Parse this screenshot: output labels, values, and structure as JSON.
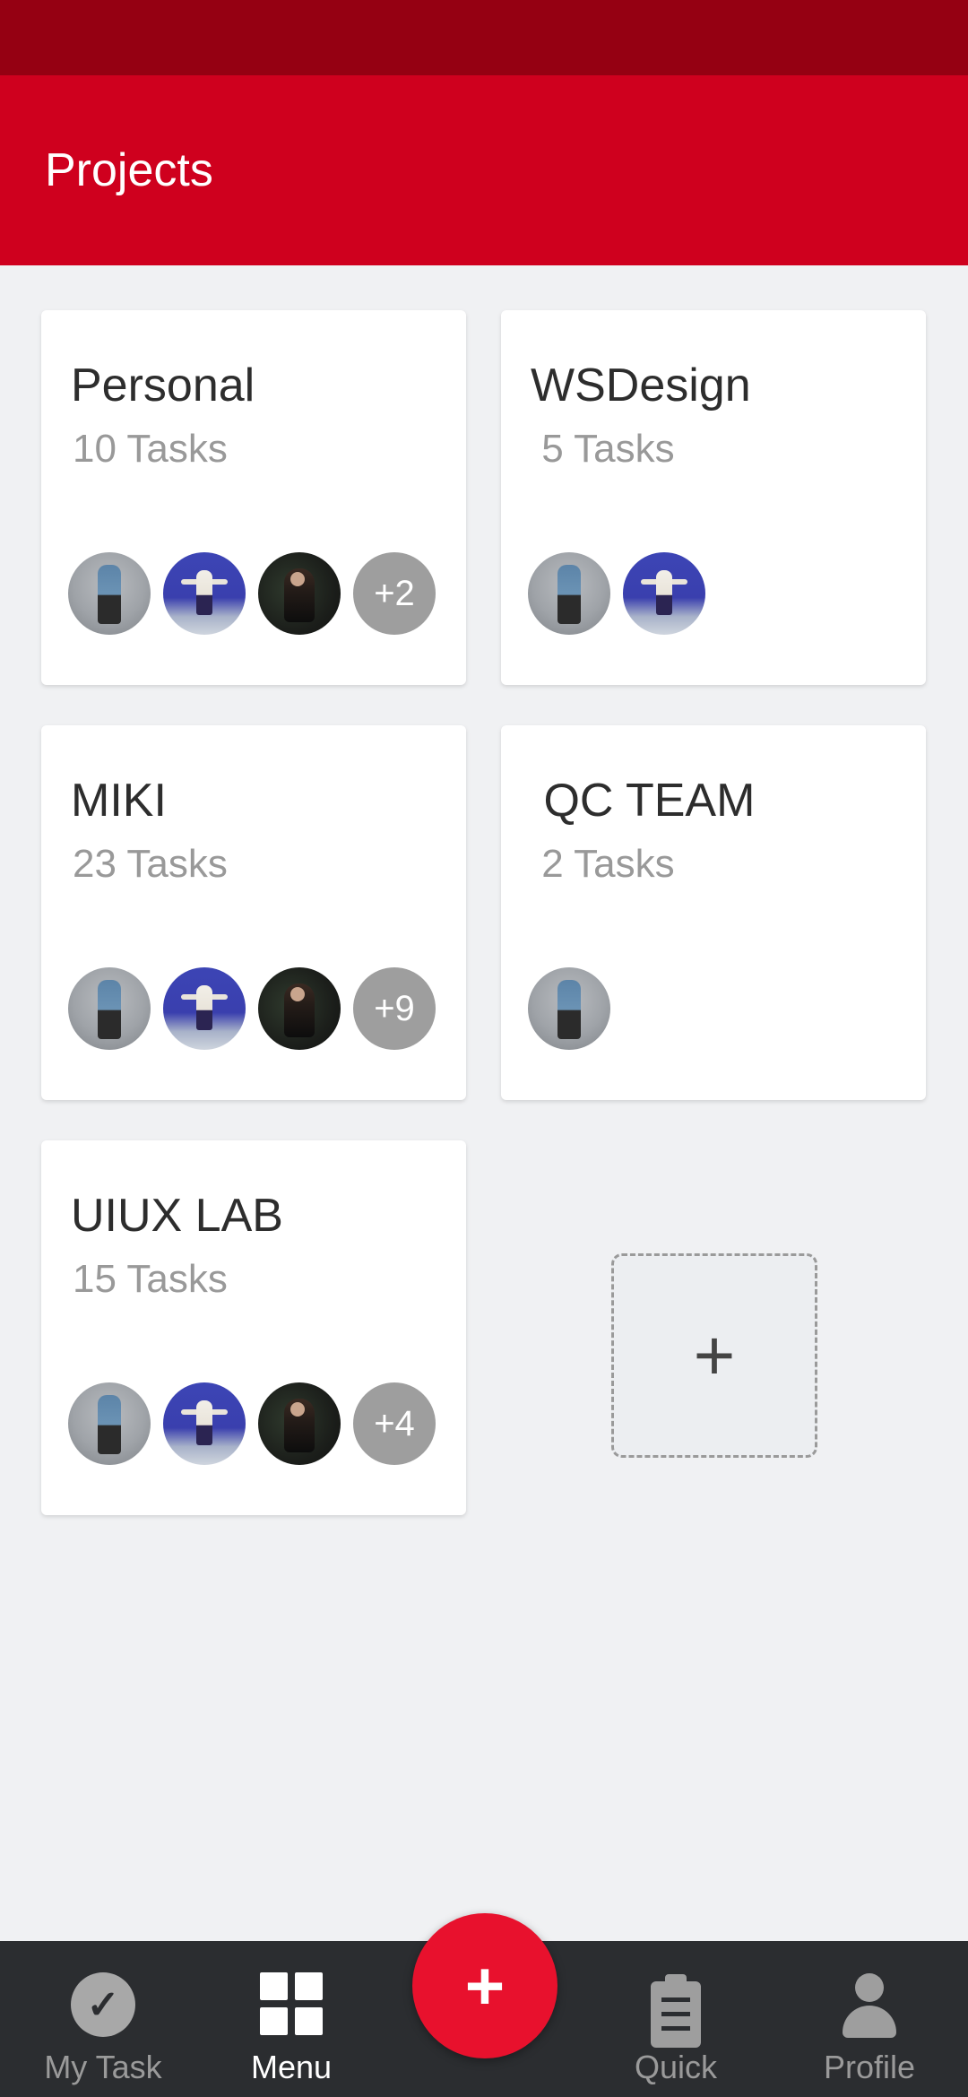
{
  "header": {
    "title": "Projects"
  },
  "projects": [
    {
      "name": "Personal",
      "tasks": "10 Tasks",
      "more": "+2"
    },
    {
      "name": "WSDesign",
      "tasks": " 5 Tasks",
      "more": ""
    },
    {
      "name": "MIKI",
      "tasks": "23 Tasks",
      "more": "+9"
    },
    {
      "name": " QC TEAM",
      "tasks": " 2 Tasks",
      "more": ""
    },
    {
      "name": "UIUX LAB",
      "tasks": "15 Tasks",
      "more": "+4"
    }
  ],
  "add_project": {
    "icon": "plus-icon",
    "symbol": "+"
  },
  "nav": {
    "my_task": "My Task",
    "menu": "Menu",
    "quick": "Quick",
    "profile": "Profile",
    "fab_symbol": "+"
  },
  "colors": {
    "status_bar": "#950012",
    "app_bar": "#cf001e",
    "fab": "#e8112d",
    "nav_bg": "#2b2d30",
    "background": "#f0f1f3"
  }
}
